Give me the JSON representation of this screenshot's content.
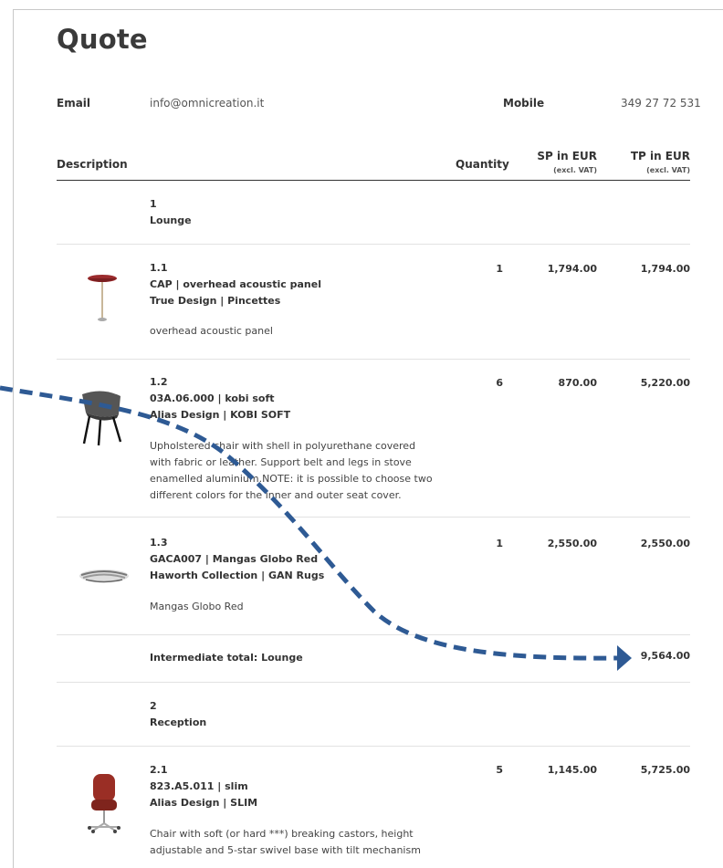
{
  "title": "Quote",
  "contact": {
    "email_label": "Email",
    "email_value": "info@omnicreation.it",
    "mobile_label": "Mobile",
    "mobile_value": "349 27 72 531"
  },
  "table": {
    "headers": {
      "description": "Description",
      "quantity": "Quantity",
      "sp": "SP in EUR",
      "sp_sub": "(excl. VAT)",
      "tp": "TP in EUR",
      "tp_sub": "(excl. VAT)"
    },
    "groups": [
      {
        "number": "1",
        "name": "Lounge",
        "items": [
          {
            "number": "1.1",
            "code_line": "CAP | overhead acoustic panel",
            "brand_line": "True Design | Pincettes",
            "description": "overhead acoustic panel",
            "quantity": "1",
            "sp": "1,794.00",
            "tp": "1,794.00",
            "image_icon": "pendant-lamp-icon"
          },
          {
            "number": "1.2",
            "code_line": "03A.06.000 | kobi soft",
            "brand_line": "Alias Design | KOBI SOFT",
            "description": "Upholstered chair with shell in polyurethane covered with fabric or leather. Support belt and legs in stove enamelled aluminium.NOTE: it is possible to choose two different colors for the inner and outer seat cover.",
            "quantity": "6",
            "sp": "870.00",
            "tp": "5,220.00",
            "image_icon": "chair-icon"
          },
          {
            "number": "1.3",
            "code_line": "GACA007 | Mangas Globo Red",
            "brand_line": "Haworth Collection | GAN Rugs",
            "description": "Mangas Globo Red",
            "quantity": "1",
            "sp": "2,550.00",
            "tp": "2,550.00",
            "image_icon": "rug-icon"
          }
        ],
        "subtotal_label": "Intermediate total: Lounge",
        "subtotal_value": "9,564.00"
      },
      {
        "number": "2",
        "name": "Reception",
        "items": [
          {
            "number": "2.1",
            "code_line": "823.A5.011 | slim",
            "brand_line": "Alias Design | SLIM",
            "description": "Chair with soft (or hard ***) breaking castors, height adjustable and 5-star swivel base with tilt mechanism",
            "quantity": "5",
            "sp": "1,145.00",
            "tp": "5,725.00",
            "image_icon": "office-chair-icon"
          }
        ]
      }
    ]
  },
  "annotation": {
    "arrow_color": "#2e5a94",
    "arrow_icon": "dashed-arrow-icon"
  }
}
